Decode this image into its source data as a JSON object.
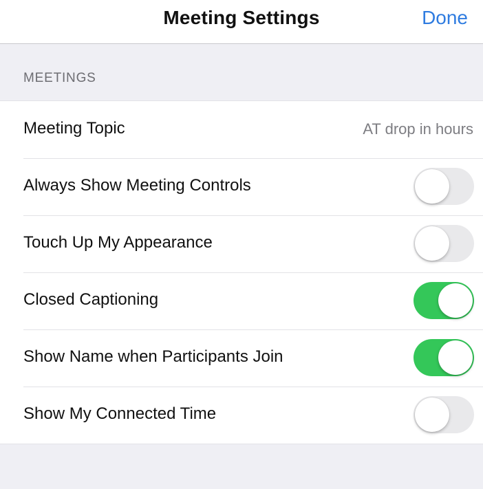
{
  "header": {
    "title": "Meeting Settings",
    "done_label": "Done"
  },
  "section": {
    "title": "MEETINGS"
  },
  "rows": [
    {
      "label": "Meeting Topic",
      "value": "AT drop in hours"
    },
    {
      "label": "Always Show Meeting Controls",
      "toggle": false
    },
    {
      "label": "Touch Up My Appearance",
      "toggle": false
    },
    {
      "label": "Closed Captioning",
      "toggle": true
    },
    {
      "label": "Show Name when Participants Join",
      "toggle": true
    },
    {
      "label": "Show My Connected Time",
      "toggle": false
    }
  ],
  "colors": {
    "accent": "#2f7ce0",
    "toggle_on": "#34c759",
    "toggle_off": "#e9e9eb",
    "background": "#efeff4"
  }
}
